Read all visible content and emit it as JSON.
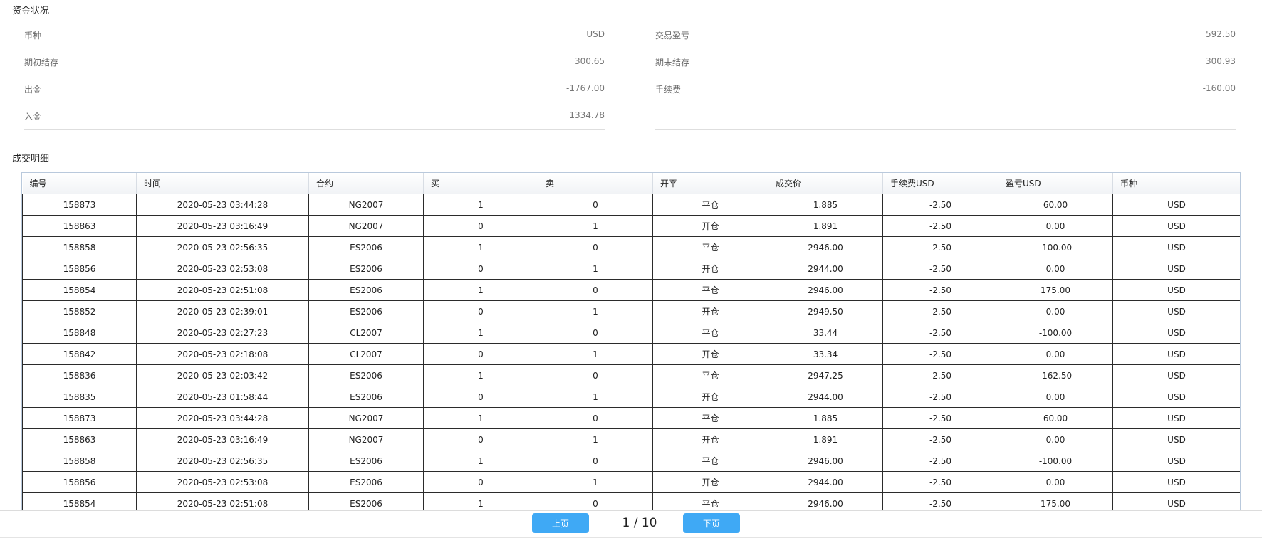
{
  "funds": {
    "title": "资金状况",
    "left": [
      {
        "label": "币种",
        "value": "USD"
      },
      {
        "label": "期初结存",
        "value": "300.65"
      },
      {
        "label": "出金",
        "value": "-1767.00"
      },
      {
        "label": "入金",
        "value": "1334.78"
      }
    ],
    "right": [
      {
        "label": "交易盈亏",
        "value": "592.50"
      },
      {
        "label": "期末结存",
        "value": "300.93"
      },
      {
        "label": "手续费",
        "value": "-160.00"
      },
      {
        "label": "",
        "value": ""
      }
    ]
  },
  "trades": {
    "title": "成交明细",
    "columns": [
      "编号",
      "时间",
      "合约",
      "买",
      "卖",
      "开平",
      "成交价",
      "手续费USD",
      "盈亏USD",
      "币种"
    ],
    "rows": [
      [
        "158873",
        "2020-05-23 03:44:28",
        "NG2007",
        "1",
        "0",
        "平仓",
        "1.885",
        "-2.50",
        "60.00",
        "USD"
      ],
      [
        "158863",
        "2020-05-23 03:16:49",
        "NG2007",
        "0",
        "1",
        "开仓",
        "1.891",
        "-2.50",
        "0.00",
        "USD"
      ],
      [
        "158858",
        "2020-05-23 02:56:35",
        "ES2006",
        "1",
        "0",
        "平仓",
        "2946.00",
        "-2.50",
        "-100.00",
        "USD"
      ],
      [
        "158856",
        "2020-05-23 02:53:08",
        "ES2006",
        "0",
        "1",
        "开仓",
        "2944.00",
        "-2.50",
        "0.00",
        "USD"
      ],
      [
        "158854",
        "2020-05-23 02:51:08",
        "ES2006",
        "1",
        "0",
        "平仓",
        "2946.00",
        "-2.50",
        "175.00",
        "USD"
      ],
      [
        "158852",
        "2020-05-23 02:39:01",
        "ES2006",
        "0",
        "1",
        "开仓",
        "2949.50",
        "-2.50",
        "0.00",
        "USD"
      ],
      [
        "158848",
        "2020-05-23 02:27:23",
        "CL2007",
        "1",
        "0",
        "平仓",
        "33.44",
        "-2.50",
        "-100.00",
        "USD"
      ],
      [
        "158842",
        "2020-05-23 02:18:08",
        "CL2007",
        "0",
        "1",
        "开仓",
        "33.34",
        "-2.50",
        "0.00",
        "USD"
      ],
      [
        "158836",
        "2020-05-23 02:03:42",
        "ES2006",
        "1",
        "0",
        "平仓",
        "2947.25",
        "-2.50",
        "-162.50",
        "USD"
      ],
      [
        "158835",
        "2020-05-23 01:58:44",
        "ES2006",
        "0",
        "1",
        "开仓",
        "2944.00",
        "-2.50",
        "0.00",
        "USD"
      ],
      [
        "158873",
        "2020-05-23 03:44:28",
        "NG2007",
        "1",
        "0",
        "平仓",
        "1.885",
        "-2.50",
        "60.00",
        "USD"
      ],
      [
        "158863",
        "2020-05-23 03:16:49",
        "NG2007",
        "0",
        "1",
        "开仓",
        "1.891",
        "-2.50",
        "0.00",
        "USD"
      ],
      [
        "158858",
        "2020-05-23 02:56:35",
        "ES2006",
        "1",
        "0",
        "平仓",
        "2946.00",
        "-2.50",
        "-100.00",
        "USD"
      ],
      [
        "158856",
        "2020-05-23 02:53:08",
        "ES2006",
        "0",
        "1",
        "开仓",
        "2944.00",
        "-2.50",
        "0.00",
        "USD"
      ],
      [
        "158854",
        "2020-05-23 02:51:08",
        "ES2006",
        "1",
        "0",
        "平仓",
        "2946.00",
        "-2.50",
        "175.00",
        "USD"
      ]
    ]
  },
  "pager": {
    "prev_label": "上页",
    "next_label": "下页",
    "indicator": "1 / 10"
  },
  "colors": {
    "button": "#3fa9f5",
    "table_border": "#2b2b2b"
  }
}
